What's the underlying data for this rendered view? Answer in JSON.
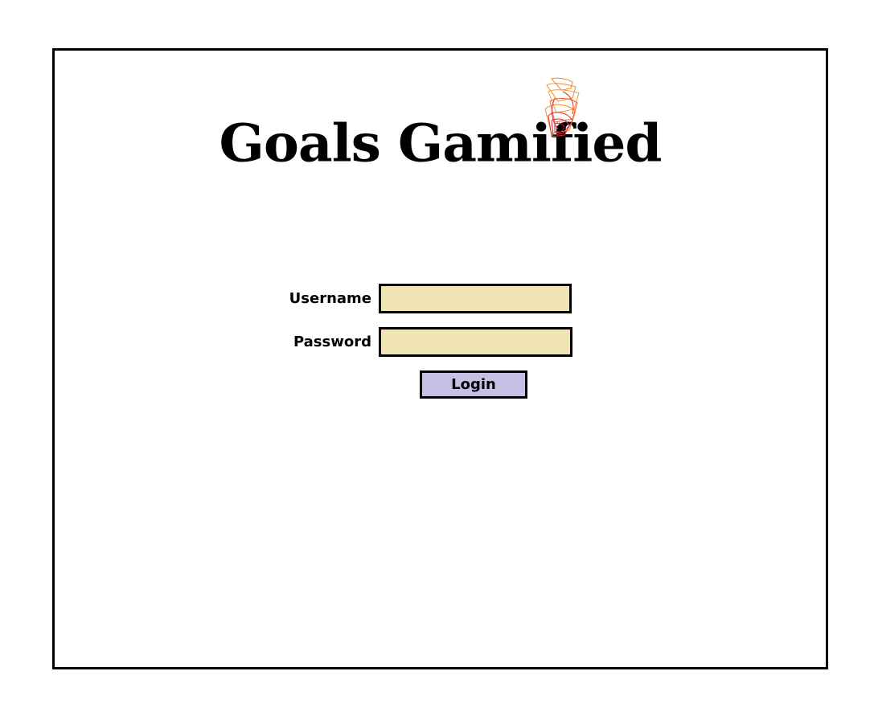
{
  "app": {
    "title": "Goals Gamified",
    "logo_icon": "flame-icon"
  },
  "login_form": {
    "username_label": "Username",
    "username_value": "",
    "password_label": "Password",
    "password_value": "",
    "login_button_label": "Login"
  },
  "colors": {
    "input_background": "#f0e4b6",
    "button_background": "#c6c0e6",
    "flame_red": "#e83030",
    "flame_orange": "#f08a28",
    "border": "#000000"
  }
}
